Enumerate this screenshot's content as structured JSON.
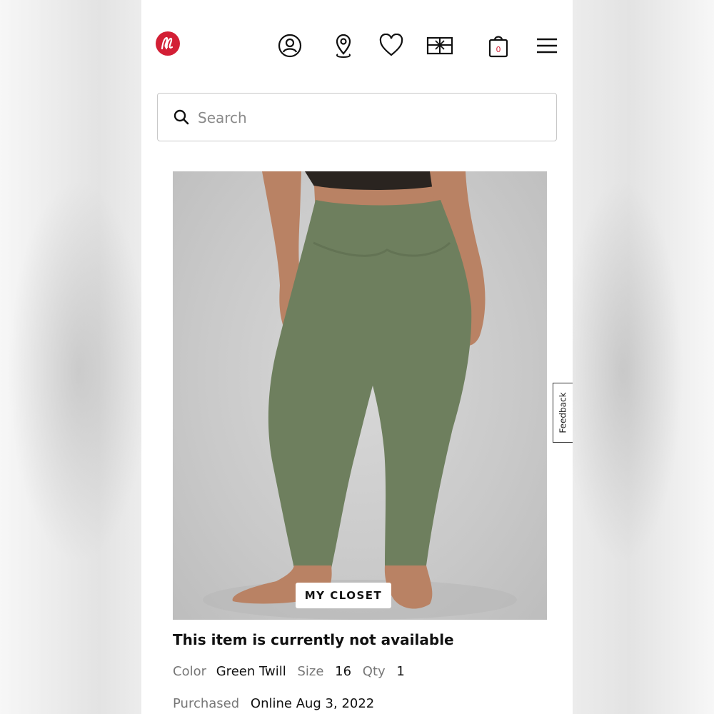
{
  "header": {
    "logo": "lululemon-logo",
    "icons": [
      "account-icon",
      "store-locator-icon",
      "wishlist-icon",
      "gift-card-icon",
      "bag-icon",
      "menu-icon"
    ],
    "bag_count": "0"
  },
  "search": {
    "placeholder": "Search",
    "value": ""
  },
  "product": {
    "image_alt": "green leggings product photo",
    "closet_label": "MY CLOSET",
    "status": "This item is currently not available",
    "color_label": "Color",
    "color_value": "Green Twill",
    "size_label": "Size",
    "size_value": "16",
    "qty_label": "Qty",
    "qty_value": "1",
    "purchased_label": "Purchased",
    "purchased_value": "Online Aug 3, 2022"
  },
  "feedback": {
    "label": "Feedback"
  },
  "colors": {
    "brand_red": "#d31f35",
    "legging_green": "#6e7f5e",
    "skin": "#b98264",
    "photo_bg": "#cdcdcd"
  }
}
